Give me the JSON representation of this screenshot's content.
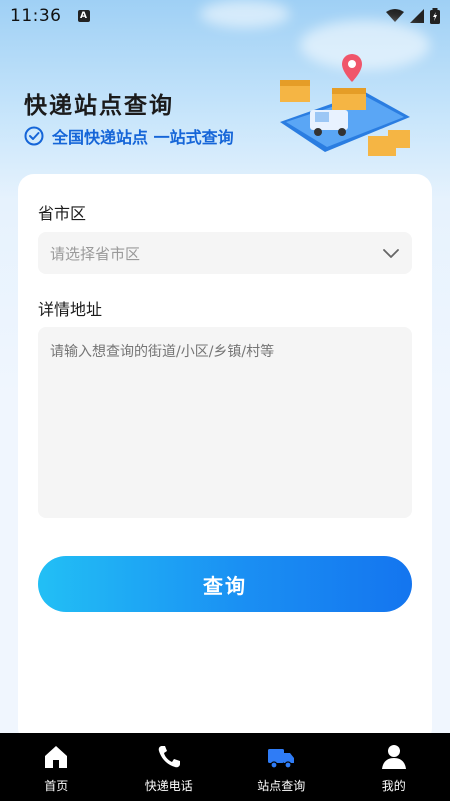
{
  "status_bar": {
    "time": "11:36",
    "badge": "A"
  },
  "hero": {
    "title": "快递站点查询",
    "subtitle": "全国快递站点 一站式查询"
  },
  "form": {
    "region_label": "省市区",
    "region_placeholder": "请选择省市区",
    "address_label": "详情地址",
    "address_placeholder": "请输入想查询的街道/小区/乡镇/村等",
    "submit_label": "查询"
  },
  "tabbar": {
    "items": [
      {
        "label": "首页",
        "icon": "home-icon"
      },
      {
        "label": "快递电话",
        "icon": "phone-icon"
      },
      {
        "label": "站点查询",
        "icon": "truck-icon"
      },
      {
        "label": "我的",
        "icon": "user-icon"
      }
    ],
    "active_index": 2
  },
  "colors": {
    "accent": "#1a8ff3",
    "subtitle": "#1565d8",
    "tab_active": "#2f7cf6",
    "tabbar_bg": "#000000"
  }
}
